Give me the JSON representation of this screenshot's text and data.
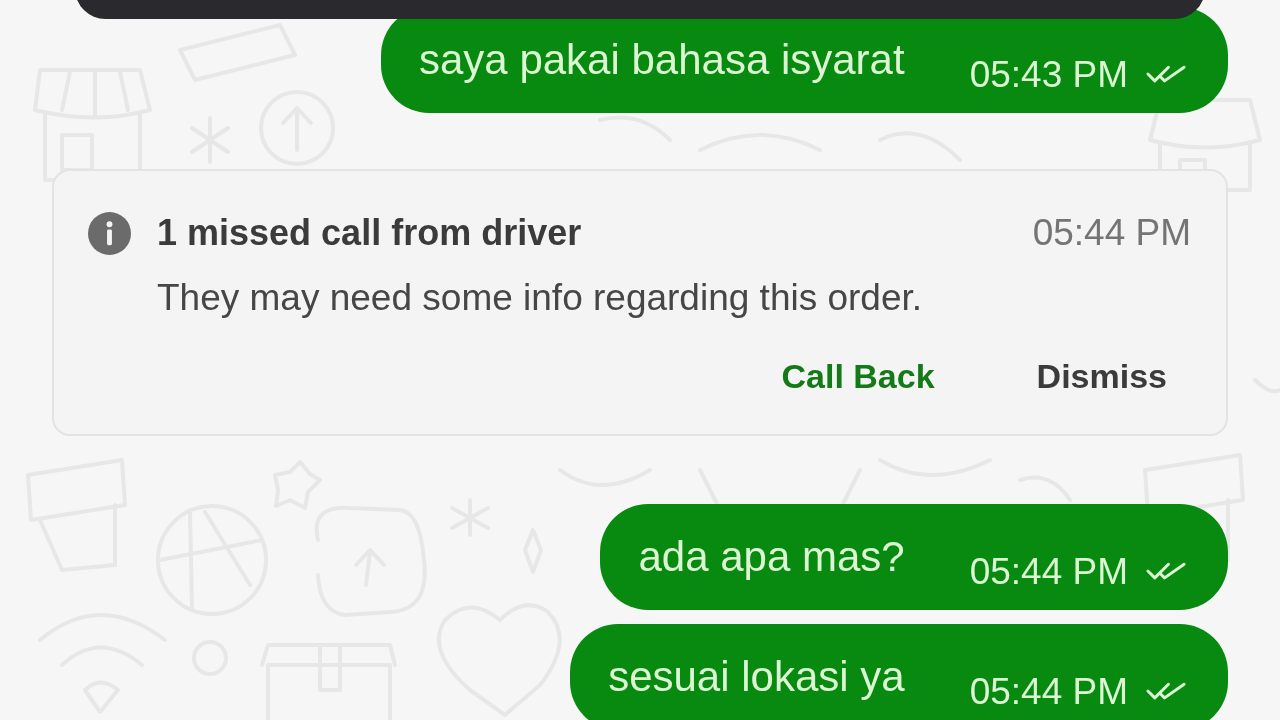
{
  "chat": {
    "messages": [
      {
        "kind": "outgoing",
        "text": "saya pakai bahasa isyarat",
        "time": "05:43 PM",
        "delivered": true
      },
      {
        "kind": "missed_call",
        "title": "1 missed call from driver",
        "time": "05:44 PM",
        "body": "They may need some info regarding this order.",
        "actions": [
          {
            "label": "Call Back",
            "kind": "primary"
          },
          {
            "label": "Dismiss",
            "kind": "secondary"
          }
        ]
      },
      {
        "kind": "outgoing",
        "text": "ada apa mas?",
        "time": "05:44 PM",
        "delivered": true
      },
      {
        "kind": "outgoing",
        "text": "sesuai lokasi ya",
        "time": "05:44 PM",
        "delivered": true
      }
    ]
  }
}
